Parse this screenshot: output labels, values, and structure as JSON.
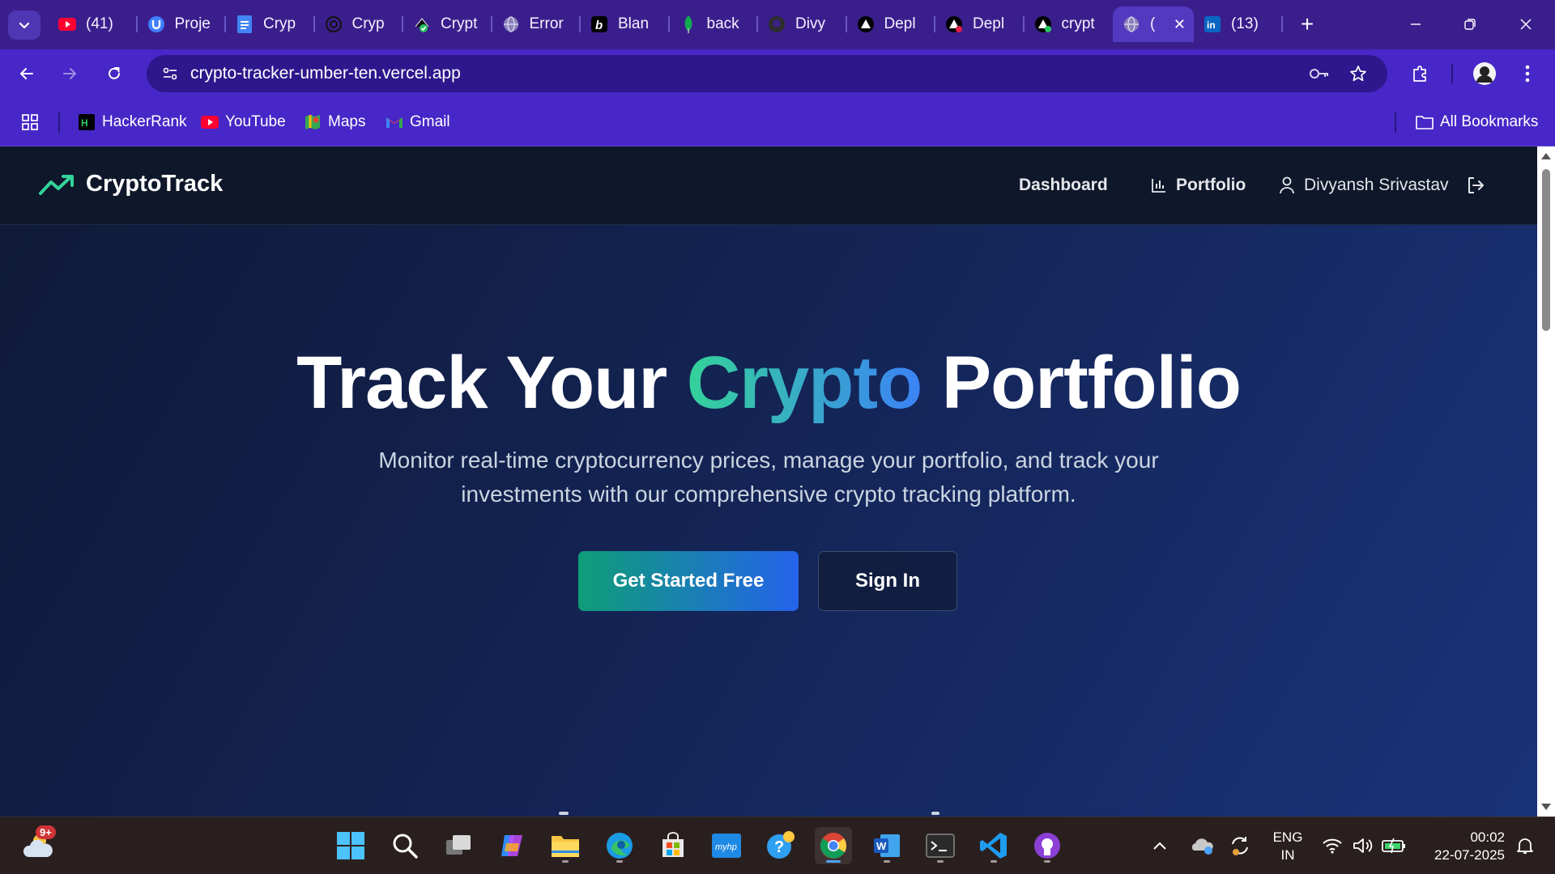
{
  "browser": {
    "tabs": [
      {
        "title": "(41) ",
        "icon": "youtube-icon",
        "color": "#ff0033"
      },
      {
        "title": "Proje",
        "icon": "u-logo-icon",
        "color": "#3f7fff"
      },
      {
        "title": "Cryp",
        "icon": "docs-icon",
        "color": "#4285f4"
      },
      {
        "title": "Cryp",
        "icon": "openai-icon",
        "color": "#111111"
      },
      {
        "title": "Crypt",
        "icon": "check-icon",
        "color": "#22c55e"
      },
      {
        "title": "Error",
        "icon": "globe-icon",
        "color": "#b8b2d6"
      },
      {
        "title": "Blan",
        "icon": "b-logo-icon",
        "color": "#000000"
      },
      {
        "title": "back",
        "icon": "mongodb-leaf-icon",
        "color": "#13aa52"
      },
      {
        "title": "Divy",
        "icon": "github-icon",
        "color": "#2d2d2d"
      },
      {
        "title": "Depl",
        "icon": "vercel-triangle-icon",
        "color": "#000000"
      },
      {
        "title": "Depl",
        "icon": "vercel-triangle-icon",
        "color": "#000000"
      },
      {
        "title": "crypt",
        "icon": "vercel-triangle-icon",
        "color": "#000000"
      },
      {
        "title": "(",
        "icon": "globe-icon",
        "color": "#b8b2d6",
        "active": true
      },
      {
        "title": "(13) ",
        "icon": "linkedin-icon",
        "color": "#0a66c2"
      }
    ],
    "url": "crypto-tracker-umber-ten.vercel.app",
    "bookmarks": [
      {
        "label": "HackerRank",
        "icon": "hackerrank-icon"
      },
      {
        "label": "YouTube",
        "icon": "youtube-icon"
      },
      {
        "label": "Maps",
        "icon": "maps-icon"
      },
      {
        "label": "Gmail",
        "icon": "gmail-icon"
      }
    ],
    "all_bookmarks_label": "All Bookmarks"
  },
  "site": {
    "brand": "CryptoTrack",
    "nav": {
      "dashboard": "Dashboard",
      "portfolio": "Portfolio",
      "user": "Divyansh Srivastav"
    },
    "hero": {
      "title_part1": "Track Your ",
      "title_accent": "Crypto",
      "title_part2": " Portfolio",
      "subtitle": "Monitor real-time cryptocurrency prices, manage your portfolio, and track your investments with our comprehensive crypto tracking platform.",
      "primary_cta": "Get Started Free",
      "secondary_cta": "Sign In"
    },
    "colors": {
      "accent_green": "#34d399",
      "accent_blue": "#3b82f6",
      "nav_bg": "#0f172a"
    }
  },
  "taskbar": {
    "weather_badge": "9+",
    "tray": {
      "lang_line1": "ENG",
      "lang_line2": "IN",
      "time": "00:02",
      "date": "22-07-2025"
    }
  }
}
